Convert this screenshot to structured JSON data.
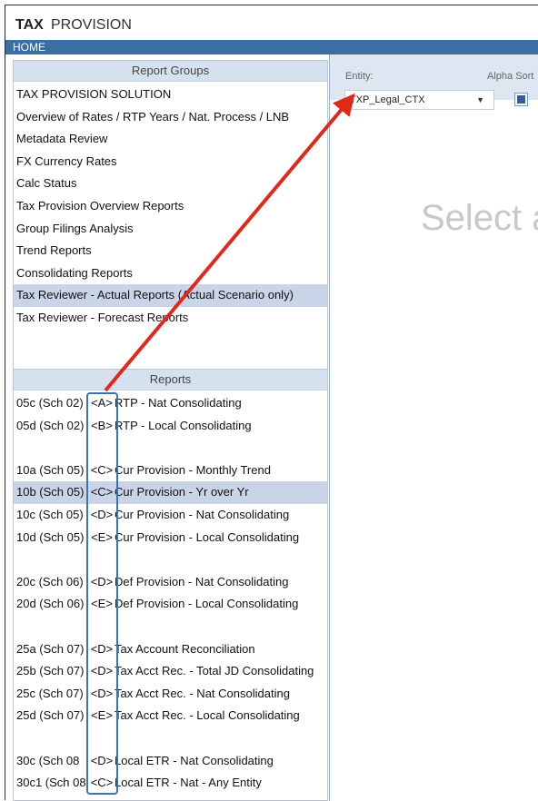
{
  "app": {
    "title_bold": "TAX",
    "title_rest": "PROVISION",
    "home_label": "HOME"
  },
  "report_groups": {
    "header": "Report Groups",
    "items": [
      "TAX PROVISION SOLUTION",
      "Overview of Rates / RTP Years / Nat. Process / LNB",
      "Metadata Review",
      "FX Currency Rates",
      "Calc Status",
      "Tax Provision Overview Reports",
      "Group Filings Analysis",
      "Trend Reports",
      "Consolidating Reports",
      "Tax Reviewer - Actual Reports  (Actual Scenario only)",
      "Tax Reviewer - Forecast Reports"
    ],
    "selected_index": 9
  },
  "reports": {
    "header": "Reports",
    "rows": [
      {
        "code": "05c  (Sch 02)",
        "letter": "<A>",
        "name": "RTP - Nat Consolidating"
      },
      {
        "code": "05d  (Sch 02)",
        "letter": "<B>",
        "name": "RTP - Local Consolidating"
      },
      {
        "gap": true
      },
      {
        "code": "10a  (Sch 05)",
        "letter": "<C>",
        "name": "Cur Provision - Monthly Trend"
      },
      {
        "code": "10b  (Sch 05)",
        "letter": "<C>",
        "name": "Cur Provision - Yr over Yr",
        "selected": true
      },
      {
        "code": "10c  (Sch 05)",
        "letter": "<D>",
        "name": "Cur Provision - Nat Consolidating"
      },
      {
        "code": "10d  (Sch 05)",
        "letter": "<E>",
        "name": "Cur Provision - Local Consolidating"
      },
      {
        "gap": true
      },
      {
        "code": "20c  (Sch 06)",
        "letter": "<D>",
        "name": "Def Provision - Nat Consolidating"
      },
      {
        "code": "20d  (Sch 06)",
        "letter": "<E>",
        "name": "Def Provision - Local Consolidating"
      },
      {
        "gap": true
      },
      {
        "code": "25a  (Sch 07)",
        "letter": "<D>",
        "name": "Tax Account Reconciliation"
      },
      {
        "code": "25b  (Sch 07)",
        "letter": "<D>",
        "name": "Tax Acct Rec. - Total JD Consolidating"
      },
      {
        "code": "25c  (Sch 07)",
        "letter": "<D>",
        "name": "Tax Acct Rec. - Nat Consolidating"
      },
      {
        "code": "25d  (Sch 07)",
        "letter": "<E>",
        "name": "Tax Acct Rec. - Local Consolidating"
      },
      {
        "gap": true
      },
      {
        "code": "30c  (Sch 08",
        "letter": "<D>",
        "name": "Local ETR - Nat Consolidating"
      },
      {
        "code": "30c1 (Sch 08",
        "letter": "<C>",
        "name": "Local ETR - Nat - Any Entity"
      }
    ]
  },
  "filters": {
    "entity_label": "Entity:",
    "entity_value": "TXP_Legal_CTX",
    "alpha_label": "Alpha Sort"
  },
  "placeholder_text": "Select a",
  "colors": {
    "header_blue": "#3a6ea5",
    "selection": "#c9d4e7",
    "arrow": "#e0281b",
    "highlight_box": "#3b74b6"
  }
}
